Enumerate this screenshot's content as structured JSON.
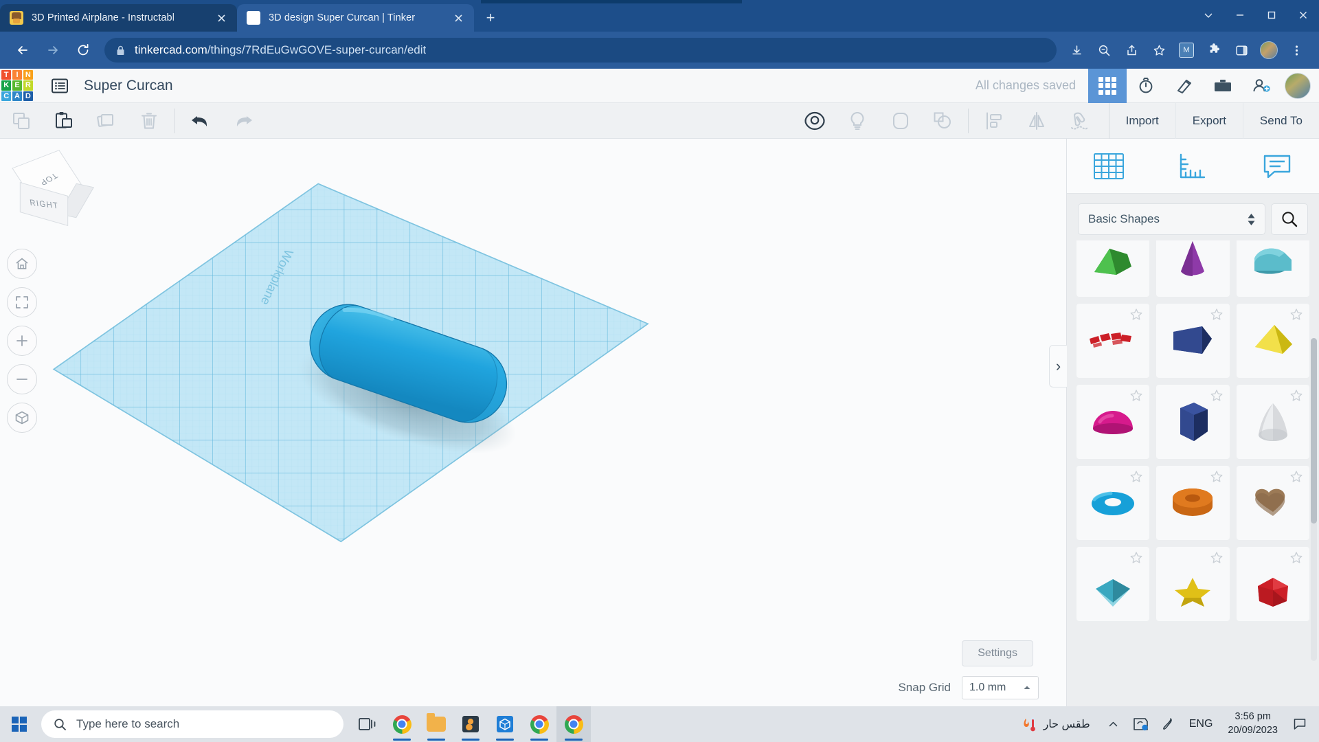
{
  "browser": {
    "tabs": [
      {
        "title": "3D Printed Airplane - Instructabl",
        "favicon": "instructables-icon",
        "active": false
      },
      {
        "title": "3D design Super Curcan | Tinker",
        "favicon": "tinkercad-icon",
        "active": true
      }
    ],
    "new_tab_label": "+",
    "window_controls": {
      "minimize": "minimize-icon",
      "maximize": "maximize-icon",
      "close": "close-icon",
      "chevron": "chevron-down-icon"
    },
    "nav": {
      "back": "back-arrow-icon",
      "forward": "forward-arrow-icon",
      "reload": "reload-icon"
    },
    "url_domain": "tinkercad.com",
    "url_path": "/things/7RdEuGwGOVE-super-curcan/edit",
    "lock": "lock-icon",
    "omni_icons": [
      "install-icon",
      "zoom-icon",
      "share-icon",
      "bookmark-star-icon",
      "extension-blue-icon",
      "puzzle-icon",
      "sidepanel-icon",
      "profile-avatar",
      "kebab-menu-icon"
    ]
  },
  "tinkercad_header": {
    "logo_letters": [
      "T",
      "I",
      "N",
      "K",
      "E",
      "R",
      "C",
      "A",
      "D"
    ],
    "logo_colors": [
      "#f0512e",
      "#fa8334",
      "#f9a11b",
      "#16a34a",
      "#57b82e",
      "#c2d92a",
      "#3aa6dd",
      "#2e86c7",
      "#1f5fa8"
    ],
    "panel_icon": "list-panel-icon",
    "design_title": "Super Curcan",
    "save_status": "All changes saved",
    "icons": [
      {
        "name": "grid-apps-icon",
        "active": true
      },
      {
        "name": "simulate-icon",
        "active": false
      },
      {
        "name": "blocks-codeblocks-icon",
        "active": false
      },
      {
        "name": "gallery-icon",
        "active": false
      },
      {
        "name": "invite-person-icon",
        "active": false
      }
    ],
    "avatar": "user-avatar"
  },
  "toolbar": {
    "left_tools": [
      {
        "name": "copy-icon",
        "enabled": false
      },
      {
        "name": "paste-icon",
        "enabled": true
      },
      {
        "name": "duplicate-icon",
        "enabled": false
      },
      {
        "name": "delete-trash-icon",
        "enabled": false
      },
      {
        "name": "undo-icon",
        "enabled": true
      },
      {
        "name": "redo-icon",
        "enabled": false
      }
    ],
    "mid_tools": [
      {
        "name": "hide-eye-icon",
        "enabled": true
      },
      {
        "name": "light-bulb-icon",
        "enabled": false
      },
      {
        "name": "group-icon",
        "enabled": false
      },
      {
        "name": "ungroup-icon",
        "enabled": false
      },
      {
        "name": "align-icon",
        "enabled": false
      },
      {
        "name": "mirror-flip-icon",
        "enabled": false
      },
      {
        "name": "magnet-snap-icon",
        "enabled": false
      }
    ],
    "import_label": "Import",
    "export_label": "Export",
    "sendto_label": "Send To"
  },
  "viewport": {
    "viewcube": {
      "top_face": "TOP",
      "front_face": "RIGHT"
    },
    "controls": [
      {
        "name": "home-view-button",
        "glyph": "home-icon"
      },
      {
        "name": "fit-view-button",
        "glyph": "fit-frame-icon"
      },
      {
        "name": "zoom-in-button",
        "glyph": "plus-icon"
      },
      {
        "name": "zoom-out-button",
        "glyph": "minus-icon"
      },
      {
        "name": "perspective-toggle-button",
        "glyph": "cube-icon"
      }
    ],
    "workplane_label": "Workplane",
    "workplane_color": "#b9e4f5",
    "workplane_grid_color": "#7fc4e0",
    "object_color": "#22a7e0",
    "settings_label": "Settings",
    "snap_grid_label": "Snap Grid",
    "snap_grid_value": "1.0 mm"
  },
  "right_panel": {
    "tabs": [
      {
        "name": "shapes-tab",
        "icon": "grid-shapes-icon"
      },
      {
        "name": "ruler-tab",
        "icon": "ruler-icon"
      },
      {
        "name": "notes-tab",
        "icon": "note-comment-icon"
      }
    ],
    "category_value": "Basic Shapes",
    "search_icon": "search-icon",
    "shape_rows": [
      [
        {
          "name": "roof-shape",
          "color": "#3aa03a",
          "kind": "wedge-roof"
        },
        {
          "name": "cone-shape",
          "color": "#8e3aa8",
          "kind": "cone"
        },
        {
          "name": "half-cylinder-shape",
          "color": "#4aacb8",
          "kind": "half-cylinder"
        }
      ],
      [
        {
          "name": "text-shape",
          "color": "#cc1f27",
          "kind": "text"
        },
        {
          "name": "wedge-shape",
          "color": "#2a3f7e",
          "kind": "wedge"
        },
        {
          "name": "pyramid-shape",
          "color": "#e6d21e",
          "kind": "pyramid"
        }
      ],
      [
        {
          "name": "half-sphere-shape",
          "color": "#d61a8c",
          "kind": "half-sphere"
        },
        {
          "name": "hexagonal-prism-shape",
          "color": "#2a3f7e",
          "kind": "hex-prism"
        },
        {
          "name": "paraboloid-shape",
          "color": "#d8dadd",
          "kind": "paraboloid"
        }
      ],
      [
        {
          "name": "torus-shape",
          "color": "#17a0d8",
          "kind": "torus"
        },
        {
          "name": "tube-shape",
          "color": "#e07a1f",
          "kind": "tube"
        },
        {
          "name": "heart-shape",
          "color": "#8a6a4a",
          "kind": "heart"
        }
      ],
      [
        {
          "name": "diamond-shape",
          "color": "#3aa8c0",
          "kind": "diamond"
        },
        {
          "name": "star-shape",
          "color": "#e0c017",
          "kind": "star"
        },
        {
          "name": "polygon-shape",
          "color": "#cc1f27",
          "kind": "polygon"
        }
      ]
    ],
    "collapse_handle": "›"
  },
  "taskbar": {
    "start": "windows-start-icon",
    "search_placeholder": "Type here to search",
    "search_icon": "search-icon",
    "apps": [
      {
        "name": "task-view-icon"
      },
      {
        "name": "chrome-taskbar-icon"
      },
      {
        "name": "file-explorer-icon"
      },
      {
        "name": "app-orange-icon"
      },
      {
        "name": "3d-viewer-icon"
      },
      {
        "name": "chrome-window-1-icon"
      },
      {
        "name": "chrome-window-2-icon"
      }
    ],
    "weather_text": "طقس حار",
    "weather_icon": "thermometer-hot-icon",
    "tray_chevron": "chevron-up-icon",
    "tray_icons": [
      "onedrive-icon",
      "pen-icon"
    ],
    "language": "ENG",
    "time": "3:56 pm",
    "date": "20/09/2023",
    "notification_icon": "notification-icon"
  }
}
